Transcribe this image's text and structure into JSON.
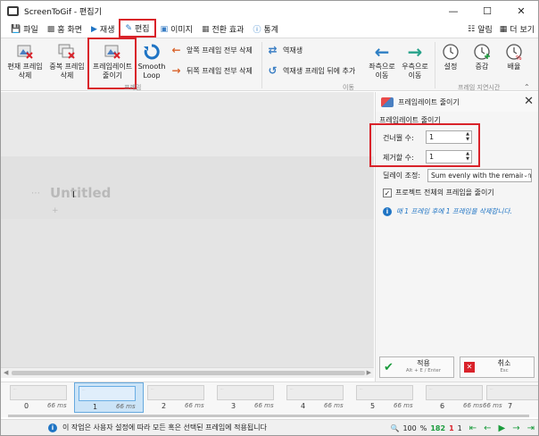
{
  "window": {
    "title": "ScreenToGif - 편집기"
  },
  "tabs": [
    {
      "label": "파일",
      "icon": "save-icon"
    },
    {
      "label": "홈 화면",
      "icon": "home-icon"
    },
    {
      "label": "재생",
      "icon": "play-icon"
    },
    {
      "label": "편집",
      "icon": "pencil-icon"
    },
    {
      "label": "이미지",
      "icon": "image-icon"
    },
    {
      "label": "전환 효과",
      "icon": "transition-icon"
    },
    {
      "label": "통계",
      "icon": "info-icon"
    }
  ],
  "tabs_right": [
    {
      "label": "알림",
      "icon": "bell-icon"
    },
    {
      "label": "더 보기",
      "icon": "more-icon"
    }
  ],
  "ribbon": {
    "delete_current": "편재 프레임\n삭제",
    "delete_duplicates": "중복 프레임\n삭제",
    "reduce_framerate": "프레임레이트\n줄이기",
    "smooth_loop": "Smooth\nLoop",
    "delete_previous": "앞쪽 프레임 전부 삭제",
    "delete_next": "뒤쪽 프레임 전부 삭제",
    "group_frames": "프레임",
    "reverse": "역재생",
    "reverse_append": "역재생 프레임 뒤에 추가",
    "move_left": "좌측으로\n이동",
    "move_right": "우측으로\n이동",
    "group_move": "이동",
    "delay_set": "설정",
    "delay_increase": "증감",
    "delay_scale": "배율",
    "group_delay": "프레임 지연시간"
  },
  "canvas": {
    "title": "Untitled"
  },
  "panel": {
    "title": "프레임레이트 줄이기",
    "subtitle": "프레임레이트 줄이기",
    "skip_label": "건너뛸 수:",
    "skip_value": "1",
    "remove_label": "제거할 수:",
    "remove_value": "1",
    "delay_label": "딜레이 조정:",
    "delay_option": "Sum evenly with the remaining frames",
    "project_checkbox": "프로젝트 전체의 프레임을 줄이기",
    "project_checked": true,
    "info_text": "매 1 프레임 후에 1 프레임을 삭제합니다.",
    "apply_label": "적용",
    "apply_shortcut": "Alt + E / Enter",
    "cancel_label": "취소",
    "cancel_shortcut": "Esc"
  },
  "timeline": {
    "frames": [
      {
        "num": "0",
        "duration": "66 ms"
      },
      {
        "num": "1",
        "duration": "66 ms"
      },
      {
        "num": "2",
        "duration": "66 ms"
      },
      {
        "num": "3",
        "duration": "66 ms"
      },
      {
        "num": "4",
        "duration": "66 ms"
      },
      {
        "num": "5",
        "duration": "66 ms"
      },
      {
        "num": "6",
        "duration": "66 ms"
      },
      {
        "num": "7",
        "duration": "66 ms"
      }
    ],
    "selected_index": 1
  },
  "status": {
    "message": "이 작업은 사용자 설정에 따라 모든 혹은 선택된 프레임에 적용됩니다",
    "zoom": "100",
    "zoom_unit": "%",
    "frame_count": "182",
    "selected_count": "1",
    "current_frame": "1"
  },
  "colors": {
    "accent": "#d9222a",
    "green": "#1a9b3c",
    "blue": "#1f74c4",
    "selection": "#cce4f7"
  }
}
